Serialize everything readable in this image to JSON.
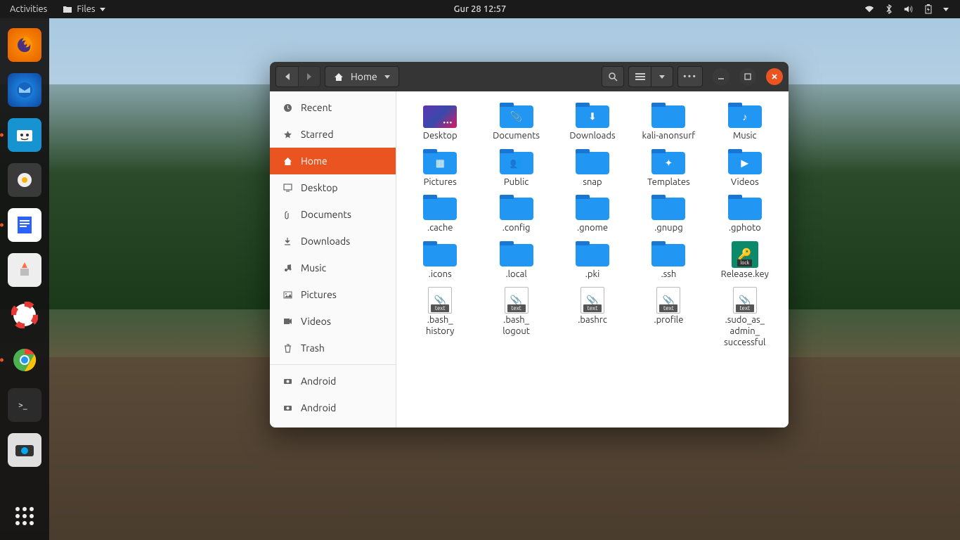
{
  "topbar": {
    "activities": "Activities",
    "app_menu": "Files",
    "clock": "Gur 28  12:57"
  },
  "window": {
    "path_label": "Home"
  },
  "sidebar": {
    "items": [
      {
        "label": "Recent",
        "icon": "clock"
      },
      {
        "label": "Starred",
        "icon": "star"
      },
      {
        "label": "Home",
        "icon": "home",
        "active": true
      },
      {
        "label": "Desktop",
        "icon": "desktop"
      },
      {
        "label": "Documents",
        "icon": "docs"
      },
      {
        "label": "Downloads",
        "icon": "download"
      },
      {
        "label": "Music",
        "icon": "music"
      },
      {
        "label": "Pictures",
        "icon": "pictures"
      },
      {
        "label": "Videos",
        "icon": "videos"
      },
      {
        "label": "Trash",
        "icon": "trash"
      }
    ],
    "devices": [
      {
        "label": "Android",
        "icon": "camera"
      },
      {
        "label": "Android",
        "icon": "camera"
      }
    ]
  },
  "files": [
    {
      "name": "Desktop",
      "type": "desktop"
    },
    {
      "name": "Documents",
      "type": "folder",
      "emblem": "📎"
    },
    {
      "name": "Downloads",
      "type": "folder",
      "emblem": "⬇"
    },
    {
      "name": "kali-anonsurf",
      "type": "folder"
    },
    {
      "name": "Music",
      "type": "folder",
      "emblem": "♪"
    },
    {
      "name": "Pictures",
      "type": "folder",
      "emblem": "▦"
    },
    {
      "name": "Public",
      "type": "folder",
      "emblem": "👥"
    },
    {
      "name": "snap",
      "type": "folder"
    },
    {
      "name": "Templates",
      "type": "folder",
      "emblem": "✦"
    },
    {
      "name": "Videos",
      "type": "folder",
      "emblem": "▶"
    },
    {
      "name": ".cache",
      "type": "folder"
    },
    {
      "name": ".config",
      "type": "folder"
    },
    {
      "name": ".gnome",
      "type": "folder"
    },
    {
      "name": ".gnupg",
      "type": "folder"
    },
    {
      "name": ".gphoto",
      "type": "folder"
    },
    {
      "name": ".icons",
      "type": "folder"
    },
    {
      "name": ".local",
      "type": "folder"
    },
    {
      "name": ".pki",
      "type": "folder"
    },
    {
      "name": ".ssh",
      "type": "folder"
    },
    {
      "name": "Release.key",
      "type": "key"
    },
    {
      "name": ".bash_\nhistory",
      "type": "text"
    },
    {
      "name": ".bash_\nlogout",
      "type": "text"
    },
    {
      "name": ".bashrc",
      "type": "text"
    },
    {
      "name": ".profile",
      "type": "text"
    },
    {
      "name": ".sudo_as_\nadmin_\nsuccessful",
      "type": "text"
    }
  ]
}
